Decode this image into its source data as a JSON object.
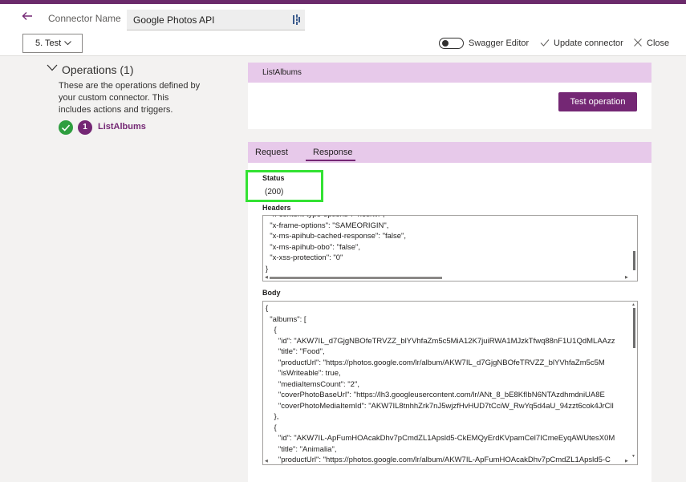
{
  "header": {
    "connector_label": "Connector Name",
    "connector_name": "Google Photos API"
  },
  "toolbar": {
    "step": "5. Test",
    "swagger_editor": "Swagger Editor",
    "update_connector": "Update connector",
    "close": "Close"
  },
  "operations": {
    "title": "Operations (1)",
    "description": "These are the operations defined by your custom connector. This includes actions and triggers.",
    "items": [
      {
        "number": "1",
        "name": "ListAlbums"
      }
    ]
  },
  "operation_card": {
    "title": "ListAlbums",
    "test_button": "Test operation"
  },
  "tabs": {
    "request": "Request",
    "response": "Response",
    "active": "Response"
  },
  "response": {
    "status_label": "Status",
    "status_value": "(200)",
    "headers_label": "Headers",
    "headers_text": "  \"x-content-type-options\": \"nosniff\",\n  \"x-frame-options\": \"SAMEORIGIN\",\n  \"x-ms-apihub-cached-response\": \"false\",\n  \"x-ms-apihub-obo\": \"false\",\n  \"x-xss-protection\": \"0\"\n}",
    "body_label": "Body",
    "body_text": "{\n  \"albums\": [\n    {\n      \"id\": \"AKW7IL_d7GjgNBOfeTRVZZ_blYVhfaZm5c5MiA12K7juiRWA1MJzkTfwq88nF1U1QdMLAAzz\n      \"title\": \"Food\",\n      \"productUrl\": \"https://photos.google.com/lr/album/AKW7IL_d7GjgNBOfeTRVZZ_blYVhfaZm5c5M\n      \"isWriteable\": true,\n      \"mediaItemsCount\": \"2\",\n      \"coverPhotoBaseUrl\": \"https://lh3.googleusercontent.com/lr/ANt_8_bE8KfIbN6NTAzdhmdniUA8E\n      \"coverPhotoMediaItemId\": \"AKW7IL8tnhhZrk7nJ5wjzfHvHUD7tCciW_RwYq5d4aU_94zzt6cok4JrCll\n    },\n    {\n      \"id\": \"AKW7IL-ApFumHOAcakDhv7pCmdZL1Apsld5-CkEMQyErdKVpamCel7ICmeEyqAWUtesX0M\n      \"title\": \"Animalia\",\n      \"productUrl\": \"https://photos.google.com/lr/album/AKW7IL-ApFumHOAcakDhv7pCmdZL1Apsld5-C"
  },
  "colors": {
    "accent": "#742774",
    "header_band": "#e7c9ea",
    "highlight": "#33e233",
    "top_bar": "#6b2a6b"
  }
}
